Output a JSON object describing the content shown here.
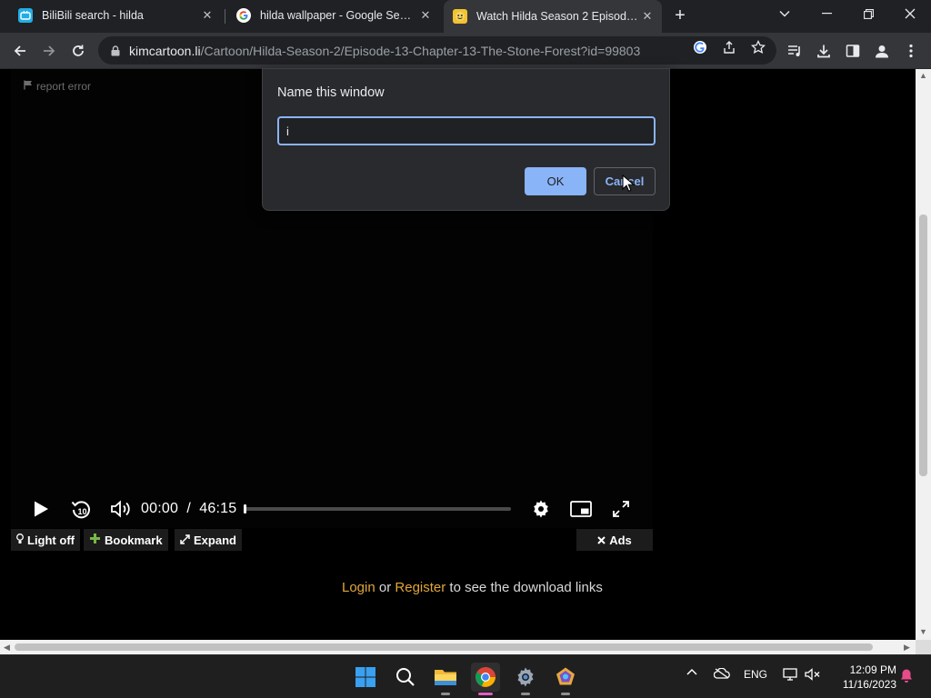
{
  "tabs": [
    {
      "title": "BiliBili search - hilda",
      "favicon": "bilibili-icon",
      "color": "#23ade5"
    },
    {
      "title": "hilda wallpaper - Google Search",
      "favicon": "google-icon",
      "color": "#4285f4"
    },
    {
      "title": "Watch Hilda Season 2 Episode 13",
      "favicon": "kimcartoon-icon",
      "color": "#f2c230"
    }
  ],
  "address_bar": {
    "host": "kimcartoon.li",
    "path": "/Cartoon/Hilda-Season-2/Episode-13-Chapter-13-The-Stone-Forest?id=99803"
  },
  "page": {
    "report_error": "report error",
    "player": {
      "current_time": "00:00",
      "separator": "/",
      "duration": "46:15",
      "progress": 0
    },
    "buttons": {
      "light_off": "Light off",
      "bookmark": "Bookmark",
      "expand": "Expand",
      "ads": "Ads"
    },
    "download": {
      "login": "Login",
      "or": " or ",
      "register": "Register",
      "rest": " to see the download links"
    }
  },
  "dialog": {
    "title": "Name this window",
    "input_value": "i",
    "ok_label": "OK",
    "cancel_label": "Cancel"
  },
  "taskbar": {
    "language": "ENG",
    "time": "12:09 PM",
    "date": "11/16/2023"
  },
  "colors": {
    "accent": "#8ab4f8",
    "link": "#e0a63a",
    "chrome_dark": "#202124",
    "toolbar": "#35363a"
  }
}
